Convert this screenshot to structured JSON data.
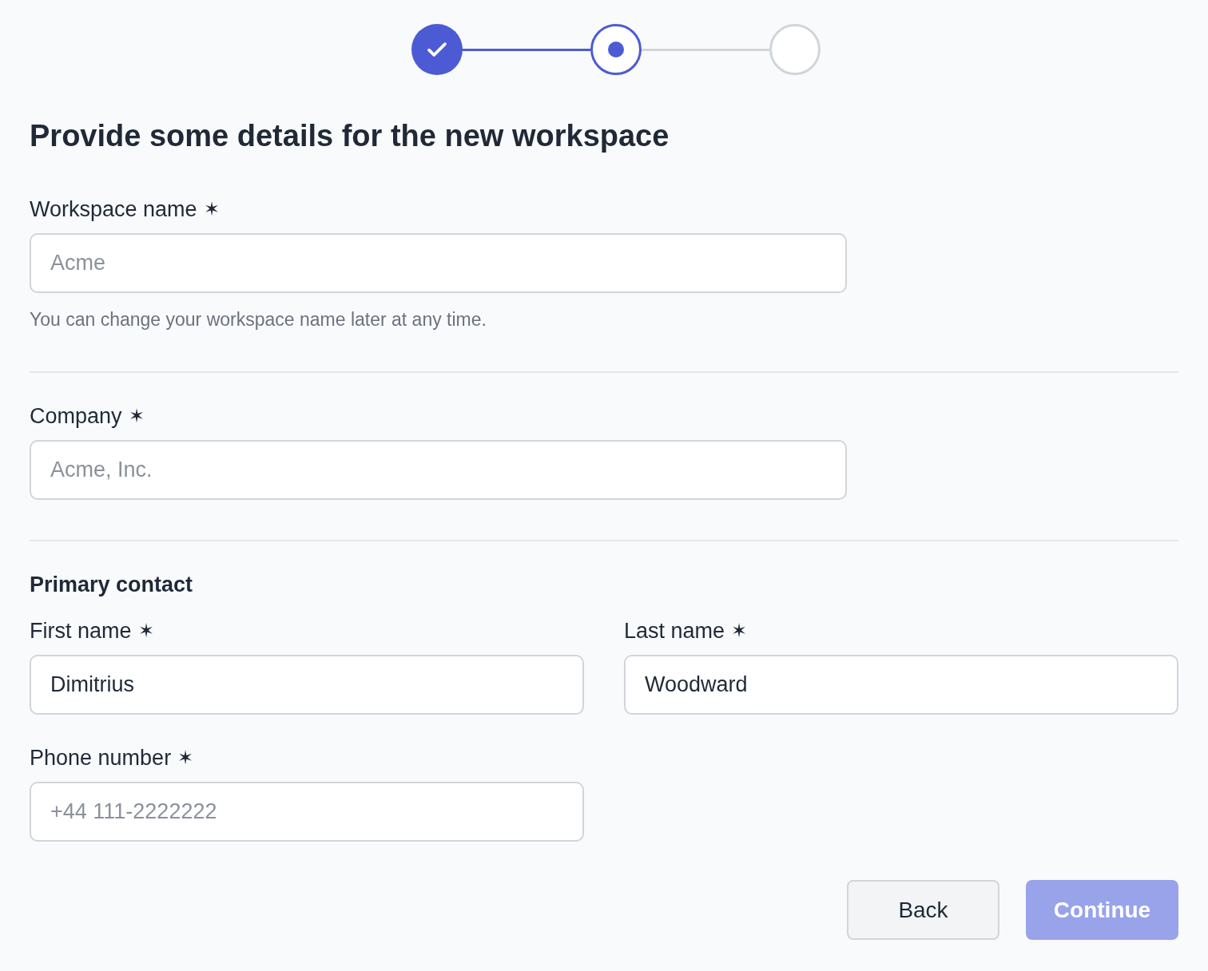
{
  "stepper": [
    {
      "completed": true,
      "selected": false
    },
    {
      "completed": false,
      "selected": true
    },
    {
      "completed": false,
      "selected": false
    }
  ],
  "title": "Provide some details for the new workspace",
  "sections": [
    {
      "fields": [
        {
          "label": "Workspace name",
          "mark": "✶",
          "placeholder": "Acme",
          "help": "You can change your workspace name later at any time."
        }
      ]
    },
    {
      "fields": [
        {
          "label": "Company",
          "mark": "✶",
          "placeholder": "Acme, Inc."
        }
      ]
    },
    {
      "heading": "Primary contact",
      "fields": [
        {
          "label": "First name",
          "mark": "✶",
          "value": "Dimitrius"
        },
        {
          "label": "Last name",
          "mark": "✶",
          "value": "Woodward"
        },
        {
          "label": "Phone number",
          "mark": "✶",
          "placeholder": "+44 111-2222222"
        }
      ]
    }
  ],
  "buttons": [
    {
      "label": "Back",
      "kind": "secondary",
      "disabled": false
    },
    {
      "label": "Continue",
      "kind": "primary",
      "disabled": true
    }
  ]
}
